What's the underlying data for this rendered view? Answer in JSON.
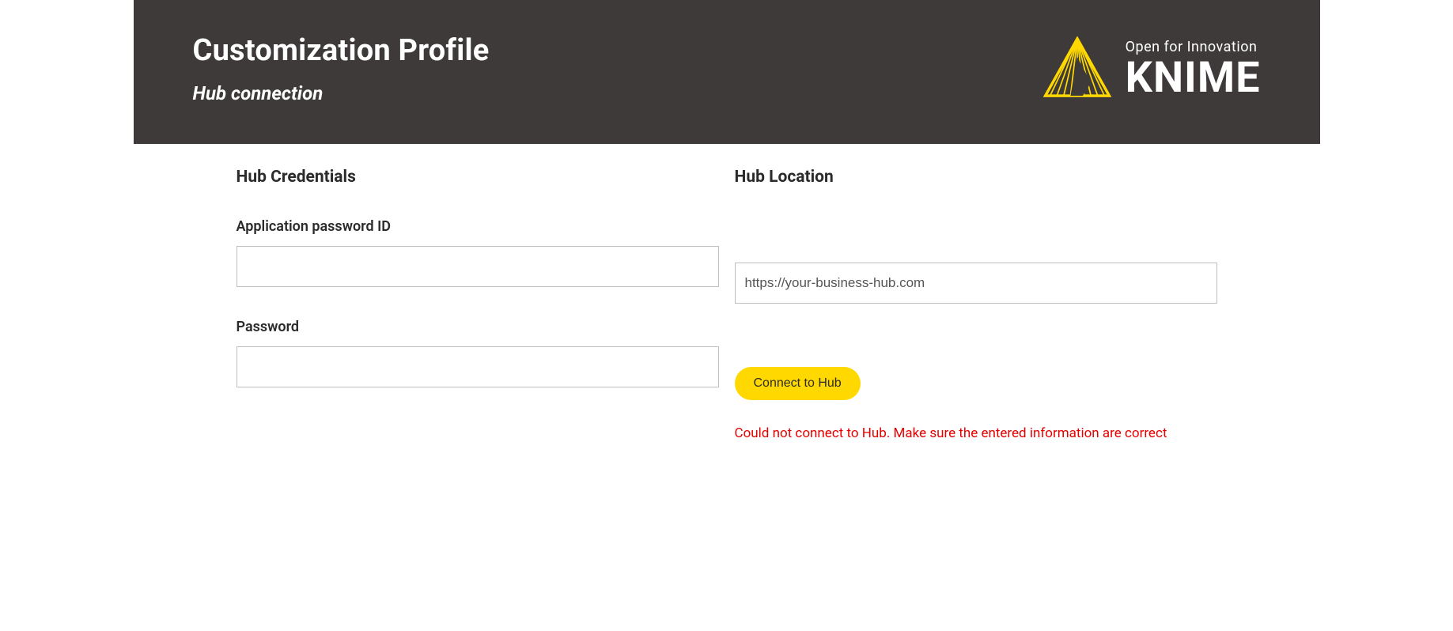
{
  "header": {
    "title": "Customization Profile",
    "subtitle": "Hub connection"
  },
  "logo": {
    "tagline": "Open for Innovation",
    "word": "KNIME"
  },
  "credentials": {
    "heading": "Hub Credentials",
    "app_pw_id_label": "Application password ID",
    "app_pw_id_value": "",
    "password_label": "Password",
    "password_value": ""
  },
  "location": {
    "heading": "Hub Location",
    "url_value": "https://your-business-hub.com",
    "connect_label": "Connect to Hub",
    "error": "Could not connect to Hub. Make sure the entered information are correct"
  },
  "colors": {
    "header_bg": "#3e3a39",
    "accent": "#ffd800",
    "error": "#e60000"
  }
}
